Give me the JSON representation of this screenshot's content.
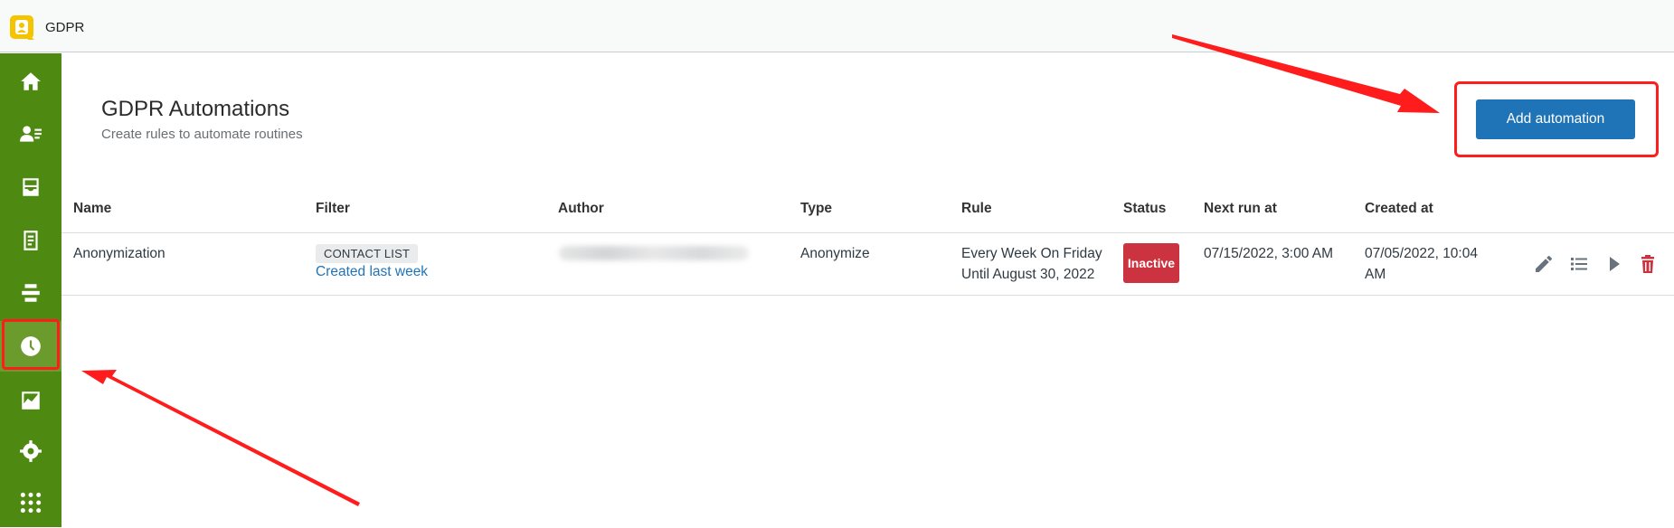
{
  "app": {
    "name": "GDPR",
    "logo_icon": "gdpr-badge-icon",
    "logo_color": "#f5c400"
  },
  "sidebar": {
    "background": "#4e8a12",
    "items": [
      {
        "icon": "home-icon",
        "active": false
      },
      {
        "icon": "contacts-icon",
        "active": false
      },
      {
        "icon": "inbox-icon",
        "active": false
      },
      {
        "icon": "document-icon",
        "active": false
      },
      {
        "icon": "align-icon",
        "active": false
      },
      {
        "icon": "clock-icon",
        "active": true
      },
      {
        "icon": "chart-icon",
        "active": false
      },
      {
        "icon": "gear-icon",
        "active": false
      },
      {
        "icon": "apps-grid-icon",
        "active": false
      }
    ]
  },
  "header": {
    "title": "GDPR Automations",
    "subtitle": "Create rules to automate routines",
    "add_button": "Add automation"
  },
  "table": {
    "columns": [
      "Name",
      "Filter",
      "Author",
      "Type",
      "Rule",
      "Status",
      "Next run at",
      "Created at"
    ],
    "rows": [
      {
        "name": "Anonymization",
        "filter_tag": "CONTACT LIST",
        "filter_link": "Created last week",
        "author": "",
        "type": "Anonymize",
        "rule_line1": "Every Week On Friday",
        "rule_line2": "Until August 30, 2022",
        "status": "Inactive",
        "next_run": "07/15/2022, 3:00 AM",
        "created_line1": "07/05/2022, 10:04",
        "created_line2": "AM",
        "actions": [
          "edit-icon",
          "list-icon",
          "play-icon",
          "trash-icon"
        ]
      }
    ]
  },
  "colors": {
    "accent": "#1f73b7",
    "status_inactive": "#cc3340",
    "delete": "#cc3340",
    "annotation": "#ff1c1c"
  }
}
